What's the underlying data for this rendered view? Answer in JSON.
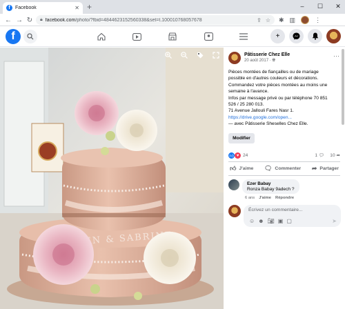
{
  "browser": {
    "tab_title": "Facebook",
    "url_host": "facebook.com",
    "url_path": "/photo/?fbid=4844623152560338&set=t.100010768057678"
  },
  "fb": {
    "logo": "f"
  },
  "post": {
    "page_name": "Pâtisserie Chez Elle",
    "date": "20 août 2017 · ",
    "body_lines": [
      "Pièces montées de fiançailles ou de mariage",
      "possible en d'autres couleurs et décorations.",
      "Commandez votre pièces montées au moins une",
      "semaine à l'avance.",
      "Infos par message privé ou par téléphone 70 851",
      "526 / 25 280 013.",
      "71 Avenue Jallouli Fares Nasr 1."
    ],
    "link": "https://drive.google.com/open...",
    "with_text": "— avec Pâtisserie Sheselles Chez Elle.",
    "edit_label": "Modifier",
    "reaction_count": "24",
    "comment_count": "1",
    "share_count": "10",
    "actions": {
      "like": "J'aime",
      "comment": "Commenter",
      "share": "Partager"
    }
  },
  "comment": {
    "author": "Ezer Babay",
    "text": "Ronza Babay 9adech ?",
    "age": "6 ans",
    "like": "J'aime",
    "reply": "Répondre"
  },
  "composer": {
    "placeholder": "Écrivez un commentaire..."
  },
  "cake": {
    "inscription": "MARWEN & SABRINE"
  },
  "colors": {
    "fb_blue": "#1877f2",
    "cake_pink": "#e4b8a2"
  }
}
